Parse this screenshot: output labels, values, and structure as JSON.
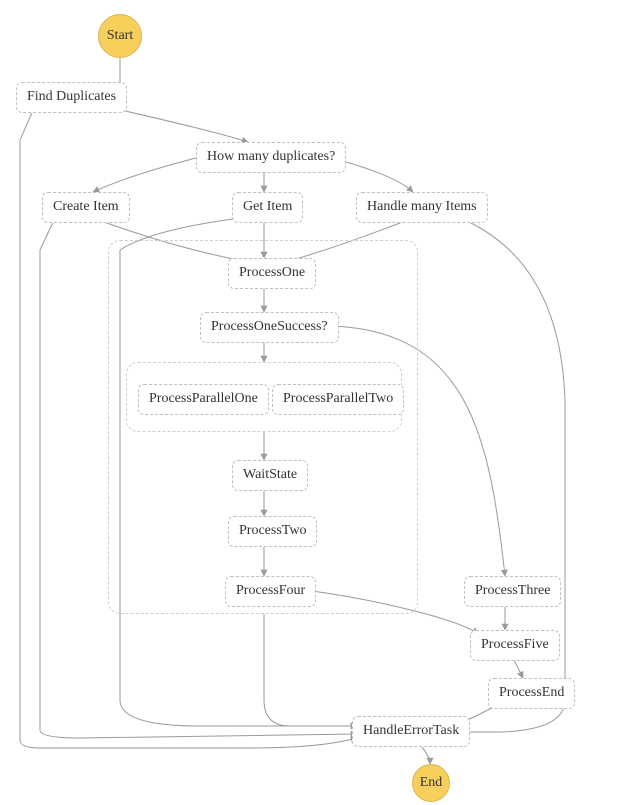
{
  "diagram": {
    "type": "flowchart",
    "colors": {
      "node_border": "#bfbfbf",
      "arrow": "#9a9a9a",
      "group_border": "#cfcfcf",
      "terminal_fill": "#f7cf5b",
      "terminal_border": "#d7b653",
      "background": "#ffffff"
    },
    "nodes": {
      "start": {
        "label": "Start",
        "shape": "circle"
      },
      "find_duplicates": {
        "label": "Find Duplicates",
        "shape": "task"
      },
      "how_many": {
        "label": "How many duplicates?",
        "shape": "choice"
      },
      "create_item": {
        "label": "Create Item",
        "shape": "task"
      },
      "get_item": {
        "label": "Get Item",
        "shape": "task"
      },
      "handle_many": {
        "label": "Handle many Items",
        "shape": "task"
      },
      "process_one": {
        "label": "ProcessOne",
        "shape": "task"
      },
      "process_one_succ": {
        "label": "ProcessOneSuccess?",
        "shape": "choice"
      },
      "pp_one": {
        "label": "ProcessParallelOne",
        "shape": "task"
      },
      "pp_two": {
        "label": "ProcessParallelTwo",
        "shape": "task"
      },
      "wait_state": {
        "label": "WaitState",
        "shape": "task"
      },
      "process_two": {
        "label": "ProcessTwo",
        "shape": "task"
      },
      "process_four": {
        "label": "ProcessFour",
        "shape": "task"
      },
      "process_three": {
        "label": "ProcessThree",
        "shape": "task"
      },
      "process_five": {
        "label": "ProcessFive",
        "shape": "task"
      },
      "process_end": {
        "label": "ProcessEnd",
        "shape": "task"
      },
      "handle_error": {
        "label": "HandleErrorTask",
        "shape": "task"
      },
      "end": {
        "label": "End",
        "shape": "circle"
      }
    },
    "groups": {
      "outer_try": {
        "children": [
          "process_one",
          "process_one_succ",
          "parallel_group",
          "wait_state",
          "process_two",
          "process_four"
        ]
      },
      "parallel_group": {
        "children": [
          "pp_one",
          "pp_two"
        ]
      }
    },
    "edges": [
      {
        "from": "start",
        "to": "find_duplicates"
      },
      {
        "from": "find_duplicates",
        "to": "how_many"
      },
      {
        "from": "how_many",
        "to": "create_item"
      },
      {
        "from": "how_many",
        "to": "get_item"
      },
      {
        "from": "how_many",
        "to": "handle_many"
      },
      {
        "from": "create_item",
        "to": "process_one"
      },
      {
        "from": "get_item",
        "to": "process_one"
      },
      {
        "from": "handle_many",
        "to": "process_one"
      },
      {
        "from": "process_one",
        "to": "process_one_succ"
      },
      {
        "from": "process_one_succ",
        "to": "parallel_group"
      },
      {
        "from": "process_one_succ",
        "to": "process_three"
      },
      {
        "from": "parallel_group",
        "to": "wait_state"
      },
      {
        "from": "wait_state",
        "to": "process_two"
      },
      {
        "from": "process_two",
        "to": "process_four"
      },
      {
        "from": "process_four",
        "to": "process_five"
      },
      {
        "from": "process_three",
        "to": "process_five"
      },
      {
        "from": "process_five",
        "to": "process_end"
      },
      {
        "from": "process_end",
        "to": "handle_error"
      },
      {
        "from": "outer_try",
        "to": "handle_error",
        "note": "catch"
      },
      {
        "from": "find_duplicates",
        "to": "handle_error",
        "note": "catch"
      },
      {
        "from": "create_item",
        "to": "handle_error",
        "note": "catch"
      },
      {
        "from": "get_item",
        "to": "handle_error",
        "note": "catch"
      },
      {
        "from": "handle_many",
        "to": "handle_error",
        "note": "catch"
      },
      {
        "from": "handle_error",
        "to": "end"
      }
    ]
  }
}
